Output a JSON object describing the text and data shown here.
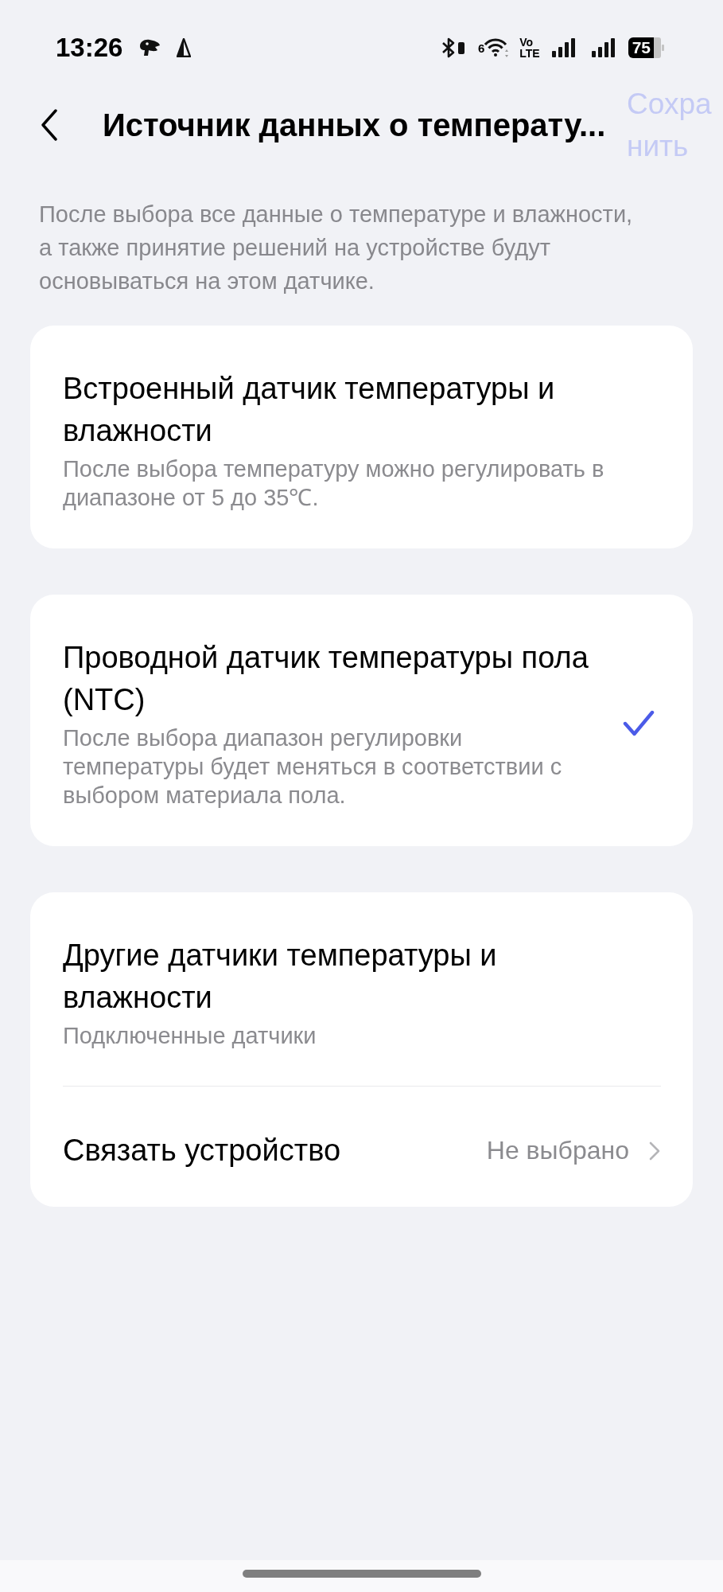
{
  "status_bar": {
    "time": "13:26",
    "wifi_generation": "6",
    "volte": [
      "Vo",
      "LTE"
    ],
    "battery": "75"
  },
  "header": {
    "title": "Источник данных о температу...",
    "save": {
      "label": "Сохранить",
      "disabled": true
    }
  },
  "description": "После выбора все данные о температуре и влажности, а также принятие решений на устройстве будут основываться на этом датчике.",
  "sources": [
    {
      "title": "Встроенный датчик температуры и влажности",
      "subtitle": "После выбора температуру можно регулировать в диапазоне от 5 до 35℃.",
      "selected": false
    },
    {
      "title": "Проводной датчик температуры пола (NTC)",
      "subtitle": "После выбора диапазон регулировки температуры будет меняться в соответствии с выбором материала пола.",
      "selected": true
    },
    {
      "title": "Другие датчики температуры и влажности",
      "subtitle": "Подключенные датчики",
      "selected": false,
      "link_row": {
        "label": "Связать устройство",
        "value": "Не выбрано"
      }
    }
  ]
}
